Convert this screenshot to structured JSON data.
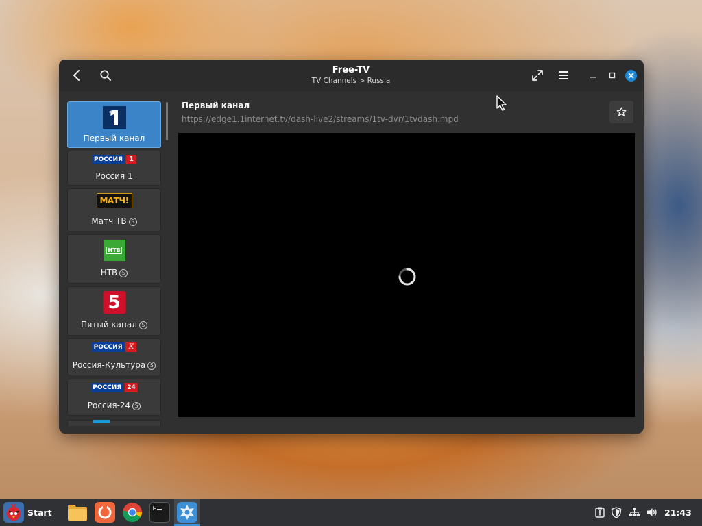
{
  "app": {
    "title": "Free-TV",
    "subtitle": "TV Channels > Russia"
  },
  "headerbar": {
    "icons": [
      "back-arrow-icon",
      "search-icon",
      "fullscreen-icon",
      "hamburger-menu-icon",
      "minimize-icon",
      "maximize-icon",
      "close-icon"
    ],
    "close_color": "#1e88d7"
  },
  "channels": [
    {
      "name": "Первый канал",
      "logo": "channel-one-logo",
      "selected": true,
      "badge": ""
    },
    {
      "name": "Россия 1",
      "logo": "russia-1-logo",
      "logo_text": "РОССИЯ",
      "logo_num": "1",
      "badge": ""
    },
    {
      "name": "Матч ТВ",
      "logo": "match-tv-logo",
      "logo_text": "МАТЧ!",
      "badge": "S"
    },
    {
      "name": "НТВ",
      "logo": "ntv-logo",
      "logo_text": "НТВ",
      "badge": "S"
    },
    {
      "name": "Пятый канал",
      "logo": "channel-five-logo",
      "logo_num": "5",
      "badge": "S"
    },
    {
      "name": "Россия-Культура",
      "logo": "russia-k-logo",
      "logo_text": "РОССИЯ",
      "logo_num": "К",
      "badge": "S"
    },
    {
      "name": "Россия-24",
      "logo": "russia-24-logo",
      "logo_text": "РОССИЯ",
      "logo_num": "24",
      "badge": "S"
    }
  ],
  "main": {
    "channel_title": "Первый канал",
    "stream_url": "https://edge1.1internet.tv/dash-live2/streams/1tv-dvr/1tvdash.mpd",
    "favorite_icon": "star-icon",
    "player_state": "loading"
  },
  "taskbar": {
    "start_label": "Start",
    "apps": [
      "files-icon",
      "firefox-icon",
      "chrome-icon",
      "terminal-icon",
      "free-tv-icon"
    ],
    "tray": [
      "update-icon",
      "shield-icon",
      "network-icon",
      "volume-icon"
    ],
    "clock": "21:43",
    "accent": "#3b8fd6"
  },
  "colors": {
    "selected_card": "#3b84c7",
    "window_bg": "#303030",
    "headerbar_bg": "#2b2b2b"
  }
}
